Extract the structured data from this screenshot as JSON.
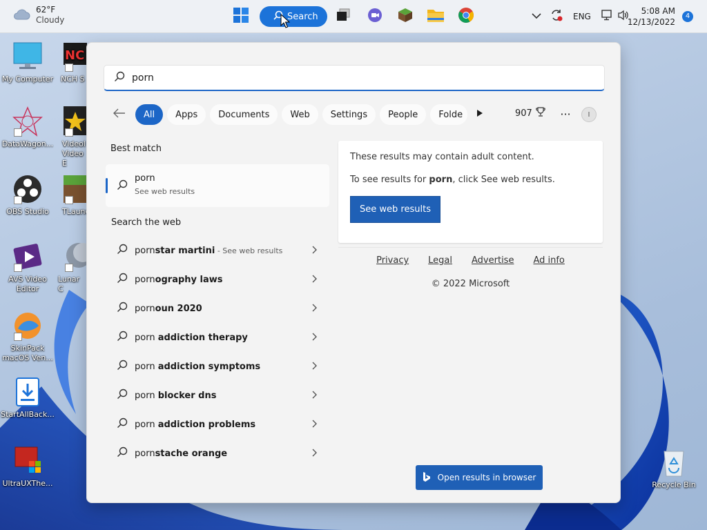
{
  "colors": {
    "accent": "#1c66c7",
    "taskbar_search": "#1c73d9",
    "button": "#1f60b6"
  },
  "taskbar": {
    "weather": {
      "temp": "62°F",
      "condition": "Cloudy",
      "icon": "cloud-icon"
    },
    "search_label": "Search",
    "tray": {
      "language": "ENG",
      "time": "5:08 AM",
      "date": "12/13/2022",
      "notifications": "4"
    }
  },
  "desktop": {
    "icons": [
      {
        "label": "My Computer"
      },
      {
        "label": "NCH S"
      },
      {
        "label": "DataWagon..."
      },
      {
        "label": "Videol Video E"
      },
      {
        "label": "OBS Studio"
      },
      {
        "label": "TLaunc"
      },
      {
        "label": "AVS Video Editor"
      },
      {
        "label": "Lunar C"
      },
      {
        "label": "SkinPack macOS Ven..."
      },
      {
        "label": "StartAllBack..."
      },
      {
        "label": "UltraUXThe..."
      },
      {
        "label": "Recycle Bin"
      }
    ]
  },
  "search": {
    "query": "porn",
    "filters": [
      "All",
      "Apps",
      "Documents",
      "Web",
      "Settings",
      "People",
      "Folde"
    ],
    "points": "907",
    "avatar_initial": "I",
    "best_match_title": "Best match",
    "best_match": {
      "title": "porn",
      "subtitle": "See web results"
    },
    "web_title": "Search the web",
    "web_results": [
      {
        "prefix": "porn",
        "bold": "star martini",
        "sub": " - See web results"
      },
      {
        "prefix": "porn",
        "bold": "ography laws",
        "sub": ""
      },
      {
        "prefix": "porn",
        "bold": "oun 2020",
        "sub": ""
      },
      {
        "prefix": "porn ",
        "bold": "addiction therapy",
        "sub": ""
      },
      {
        "prefix": "porn ",
        "bold": "addiction symptoms",
        "sub": ""
      },
      {
        "prefix": "porn ",
        "bold": "blocker dns",
        "sub": ""
      },
      {
        "prefix": "porn ",
        "bold": "addiction problems",
        "sub": ""
      },
      {
        "prefix": "porn",
        "bold": "stache orange",
        "sub": ""
      }
    ],
    "adult": {
      "line1": "These results may contain adult content.",
      "line2_pre": "To see results for ",
      "line2_bold": "porn",
      "line2_post": ", click See web results.",
      "button": "See web results"
    },
    "legal": [
      "Privacy",
      "Legal",
      "Advertise",
      "Ad info"
    ],
    "copyright": "© 2022 Microsoft",
    "open_browser": "Open results in browser"
  }
}
